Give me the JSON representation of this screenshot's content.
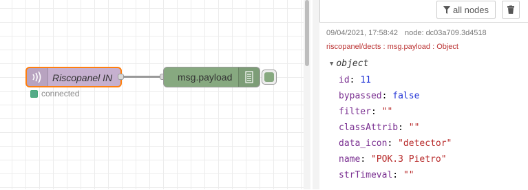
{
  "flow": {
    "input_node_label": "Riscopanel IN",
    "debug_node_label": "msg.payload",
    "input_status": "connected",
    "colors": {
      "input_node": "#c6b0cf",
      "debug_node": "#87a980",
      "selected_border": "#ff7f0e",
      "status_dot": "#55aa88"
    },
    "icons": {
      "input_icon": "wireless-icon",
      "debug_icon": "list-icon"
    }
  },
  "sidebar": {
    "filter_label": "all nodes",
    "filter_icon": "filter-icon",
    "clear_icon": "trash-icon",
    "message": {
      "timestamp": "09/04/2021, 17:58:42",
      "node": "node: dc03a709.3d4518",
      "topic": "riscopanel/dects : msg.payload : Object",
      "object_type": "object",
      "properties": [
        {
          "key": "id",
          "value": "11",
          "type": "number"
        },
        {
          "key": "bypassed",
          "value": "false",
          "type": "boolean"
        },
        {
          "key": "filter",
          "value": "\"\"",
          "type": "string"
        },
        {
          "key": "classAttrib",
          "value": "\"\"",
          "type": "string"
        },
        {
          "key": "data_icon",
          "value": "\"detector\"",
          "type": "string"
        },
        {
          "key": "name",
          "value": "\"POK.3 Pietro\"",
          "type": "string"
        },
        {
          "key": "strTimeval",
          "value": "\"\"",
          "type": "string"
        }
      ]
    }
  }
}
